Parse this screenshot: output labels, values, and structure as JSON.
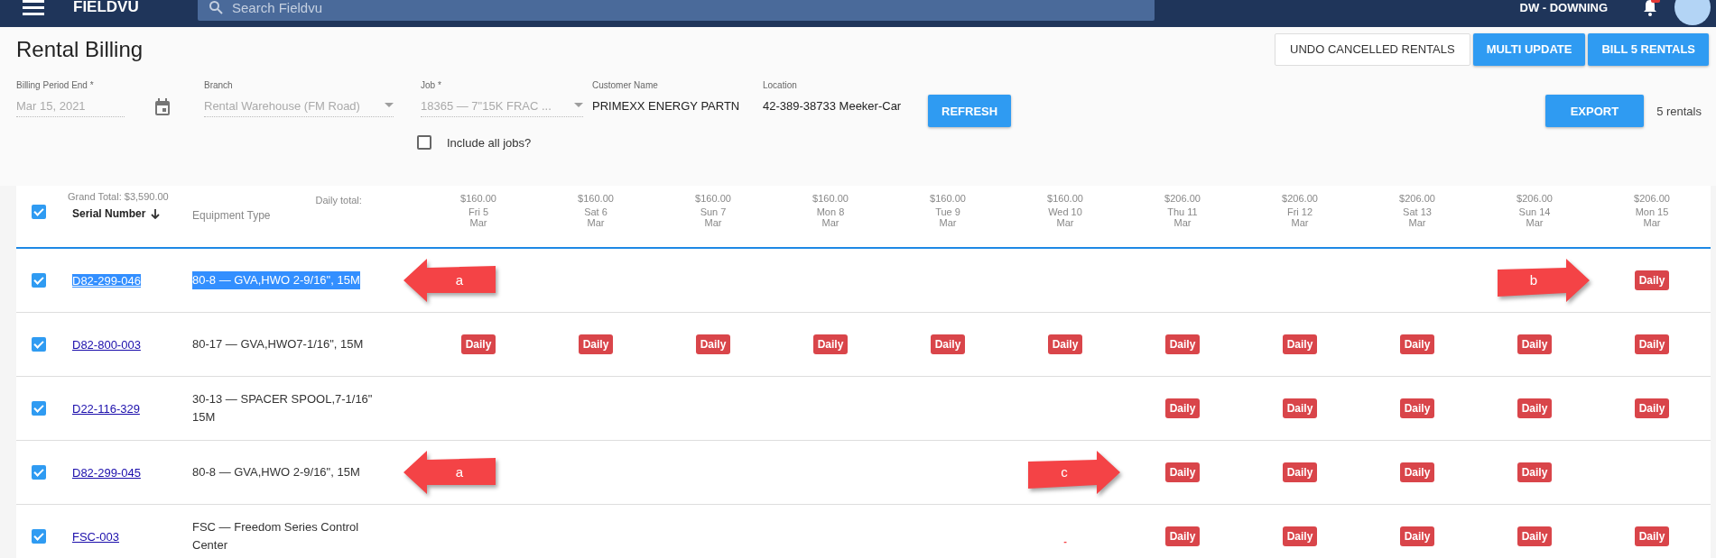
{
  "topbar": {
    "app_name": "FIELDVU",
    "search": {
      "placeholder": "Search Fieldvu"
    },
    "user": "DW - DOWNING",
    "notifications": {
      "unread": true
    }
  },
  "page": {
    "title": "Rental Billing",
    "actions": [
      {
        "label": "UNDO CANCELLED RENTALS",
        "kind": "outlined"
      },
      {
        "label": "MULTI UPDATE",
        "kind": "primary"
      },
      {
        "label": "BILL 5 RENTALS",
        "kind": "primary"
      }
    ]
  },
  "filters": [
    {
      "label": "Billing Period End *",
      "value": "Mar 15, 2021",
      "kind": "date",
      "disabled": true
    },
    {
      "label": "Branch",
      "value": "Rental Warehouse (FM Road)",
      "kind": "select",
      "disabled": true
    },
    {
      "label": "Job *",
      "value": "18365 — 7\"15K FRAC ...",
      "kind": "select",
      "disabled": true
    },
    {
      "label": "Customer Name",
      "value": "PRIMEXX ENERGY PARTN",
      "kind": "text",
      "disabled": false
    },
    {
      "label": "Location",
      "value": "42-389-38733 Meeker-Car",
      "kind": "text",
      "disabled": false
    }
  ],
  "refresh_button": "REFRESH",
  "include_all_jobs": {
    "label": "Include all jobs?",
    "checked": false
  },
  "export_button": "EXPORT",
  "rental_count": "5 rentals",
  "table": {
    "all_checked": true,
    "grand_total": "Grand Total: $3,590.00",
    "serial_label": "Serial Number",
    "sorted": true,
    "equipment_label": "Equipment Type",
    "daily_total_label": "Daily total:",
    "days": [
      {
        "amount": "$160.00",
        "day": "Fri 5",
        "month": "Mar"
      },
      {
        "amount": "$160.00",
        "day": "Sat 6",
        "month": "Mar"
      },
      {
        "amount": "$160.00",
        "day": "Sun 7",
        "month": "Mar"
      },
      {
        "amount": "$160.00",
        "day": "Mon 8",
        "month": "Mar"
      },
      {
        "amount": "$160.00",
        "day": "Tue 9",
        "month": "Mar"
      },
      {
        "amount": "$160.00",
        "day": "Wed 10",
        "month": "Mar"
      },
      {
        "amount": "$206.00",
        "day": "Thu 11",
        "month": "Mar"
      },
      {
        "amount": "$206.00",
        "day": "Fri 12",
        "month": "Mar"
      },
      {
        "amount": "$206.00",
        "day": "Sat 13",
        "month": "Mar"
      },
      {
        "amount": "$206.00",
        "day": "Sun 14",
        "month": "Mar"
      },
      {
        "amount": "$206.00",
        "day": "Mon 15",
        "month": "Mar"
      }
    ],
    "rows": [
      {
        "checked": true,
        "serial": "D82-299-046",
        "equipment": "80-8 — GVA,HWO 2-9/16\", 15M",
        "highlighted": true,
        "callout": {
          "label": "a",
          "kind": "left"
        },
        "cells": [
          {
            "kind": "empty"
          },
          {
            "kind": "empty"
          },
          {
            "kind": "empty"
          },
          {
            "kind": "empty"
          },
          {
            "kind": "empty"
          },
          {
            "kind": "empty"
          },
          {
            "kind": "empty"
          },
          {
            "kind": "empty"
          },
          {
            "kind": "empty"
          },
          {
            "kind": "empty",
            "callout": {
              "label": "b",
              "kind": "right"
            }
          },
          {
            "kind": "badge",
            "text": "Daily"
          }
        ]
      },
      {
        "checked": true,
        "serial": "D82-800-003",
        "equipment": "80-17 — GVA,HWO7-1/16\", 15M",
        "highlighted": false,
        "cells": [
          {
            "kind": "badge",
            "text": "Daily"
          },
          {
            "kind": "badge",
            "text": "Daily"
          },
          {
            "kind": "badge",
            "text": "Daily"
          },
          {
            "kind": "badge",
            "text": "Daily"
          },
          {
            "kind": "badge",
            "text": "Daily"
          },
          {
            "kind": "badge",
            "text": "Daily"
          },
          {
            "kind": "badge",
            "text": "Daily"
          },
          {
            "kind": "badge",
            "text": "Daily"
          },
          {
            "kind": "badge",
            "text": "Daily"
          },
          {
            "kind": "badge",
            "text": "Daily"
          },
          {
            "kind": "badge",
            "text": "Daily"
          }
        ]
      },
      {
        "checked": true,
        "serial": "D22-116-329",
        "equipment": "30-13 — SPACER SPOOL,7-1/16\" 15M",
        "highlighted": false,
        "cells": [
          {
            "kind": "empty"
          },
          {
            "kind": "empty"
          },
          {
            "kind": "empty"
          },
          {
            "kind": "empty"
          },
          {
            "kind": "empty"
          },
          {
            "kind": "empty"
          },
          {
            "kind": "badge",
            "text": "Daily"
          },
          {
            "kind": "badge",
            "text": "Daily"
          },
          {
            "kind": "badge",
            "text": "Daily"
          },
          {
            "kind": "badge",
            "text": "Daily"
          },
          {
            "kind": "badge",
            "text": "Daily"
          }
        ]
      },
      {
        "checked": true,
        "serial": "D82-299-045",
        "equipment": "80-8 — GVA,HWO 2-9/16\", 15M",
        "highlighted": false,
        "callout": {
          "label": "a",
          "kind": "left"
        },
        "cells": [
          {
            "kind": "empty"
          },
          {
            "kind": "empty"
          },
          {
            "kind": "empty"
          },
          {
            "kind": "empty"
          },
          {
            "kind": "empty"
          },
          {
            "kind": "empty",
            "callout": {
              "label": "c",
              "kind": "right"
            }
          },
          {
            "kind": "badge",
            "text": "Daily"
          },
          {
            "kind": "badge",
            "text": "Daily"
          },
          {
            "kind": "badge",
            "text": "Daily"
          },
          {
            "kind": "badge",
            "text": "Daily"
          },
          {
            "kind": "empty"
          }
        ]
      },
      {
        "checked": true,
        "serial": "FSC-003",
        "equipment": "FSC — Freedom Series Control Center",
        "highlighted": false,
        "cells": [
          {
            "kind": "empty"
          },
          {
            "kind": "empty"
          },
          {
            "kind": "empty"
          },
          {
            "kind": "empty"
          },
          {
            "kind": "empty"
          },
          {
            "kind": "dash",
            "text": "-"
          },
          {
            "kind": "badge",
            "text": "Daily"
          },
          {
            "kind": "badge",
            "text": "Daily"
          },
          {
            "kind": "badge",
            "text": "Daily"
          },
          {
            "kind": "badge",
            "text": "Daily"
          },
          {
            "kind": "badge",
            "text": "Daily"
          }
        ]
      }
    ]
  }
}
